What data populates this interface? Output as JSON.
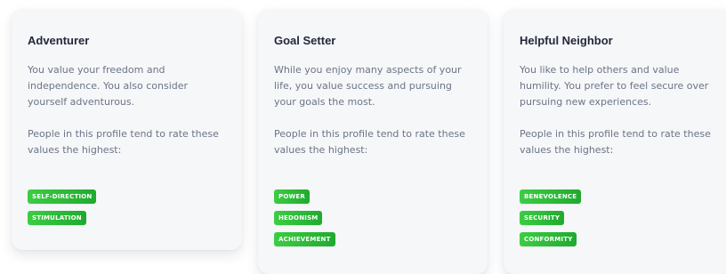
{
  "cards": [
    {
      "title": "Adventurer",
      "description": "You value your freedom and independence. You also consider yourself adventurous.",
      "note": "People in this profile tend to rate these values the highest:",
      "values": [
        "SELF-DIRECTION",
        "STIMULATION"
      ]
    },
    {
      "title": "Goal Setter",
      "description": "While you enjoy many aspects of your life, you value success and pursuing your goals the most.",
      "note": "People in this profile tend to rate these values the highest:",
      "values": [
        "POWER",
        "HEDONISM",
        "ACHIEVEMENT"
      ]
    },
    {
      "title": "Helpful Neighbor",
      "description": "You like to help others and value humility. You prefer to feel secure over pursuing new experiences.",
      "note": "People in this profile tend to rate these values the highest:",
      "values": [
        "BENEVOLENCE",
        "SECURITY",
        "CONFORMITY"
      ]
    }
  ],
  "colors": {
    "card_bg": "#f6f7f9",
    "title": "#23283a",
    "body_text": "#6b7486",
    "badge_start": "#3ccd43",
    "badge_end": "#1faa2f"
  }
}
